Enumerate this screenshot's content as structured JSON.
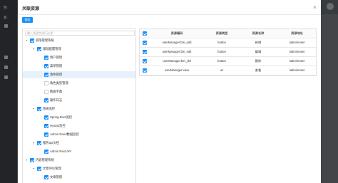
{
  "modal": {
    "title": "关联资源",
    "close_glyph": "×",
    "save_label": "保存"
  },
  "tree": {
    "search_placeholder": "输入关键字进行过滤",
    "nodes": [
      {
        "label": "权限管理系统",
        "checked": true,
        "expanded": true,
        "level": 0
      },
      {
        "label": "基础配置管理",
        "checked": true,
        "expanded": true,
        "level": 1
      },
      {
        "label": "用户管理",
        "checked": true,
        "level": 2
      },
      {
        "label": "菜单管理",
        "checked": true,
        "level": 2
      },
      {
        "label": "角色管理",
        "checked": true,
        "level": 2,
        "selected": true
      },
      {
        "label": "角色类型管理",
        "checked": false,
        "level": 2
      },
      {
        "label": "数据字典",
        "checked": false,
        "level": 2
      },
      {
        "label": "操作日志",
        "checked": true,
        "level": 2
      },
      {
        "label": "系统监控",
        "checked": true,
        "expanded": true,
        "level": 1
      },
      {
        "label": "Spring-Boot监控",
        "checked": true,
        "level": 2
      },
      {
        "label": "Hystrix监控",
        "checked": true,
        "level": 2
      },
      {
        "label": "Admin Druid数据监控",
        "checked": true,
        "level": 2
      },
      {
        "label": "服务api文档",
        "checked": true,
        "expanded": true,
        "level": 1
      },
      {
        "label": "Admin Rest API",
        "checked": true,
        "level": 2
      },
      {
        "label": "内容管理系统",
        "checked": true,
        "expanded": true,
        "level": 0
      },
      {
        "label": "文章评论管理",
        "checked": true,
        "expanded": true,
        "level": 1
      },
      {
        "label": "文章管理",
        "checked": true,
        "level": 2
      }
    ]
  },
  "table": {
    "headers": [
      "资源编码",
      "资源类型",
      "资源名称",
      "资源地址"
    ],
    "rows": [
      {
        "code": "userManager:btn_add",
        "type": "button",
        "name": "新增",
        "url": "/admin/user"
      },
      {
        "code": "userManager:btn_edit",
        "type": "button",
        "name": "编辑",
        "url": "/admin/user"
      },
      {
        "code": "userManager:btn_del",
        "type": "button",
        "name": "删除",
        "url": "/admin/user"
      },
      {
        "code": "userManager:view",
        "type": "uri",
        "name": "查看",
        "url": "/admin/user"
      }
    ]
  },
  "background": {
    "sidebar_items": [
      "预",
      "基",
      "",
      "",
      ""
    ]
  }
}
